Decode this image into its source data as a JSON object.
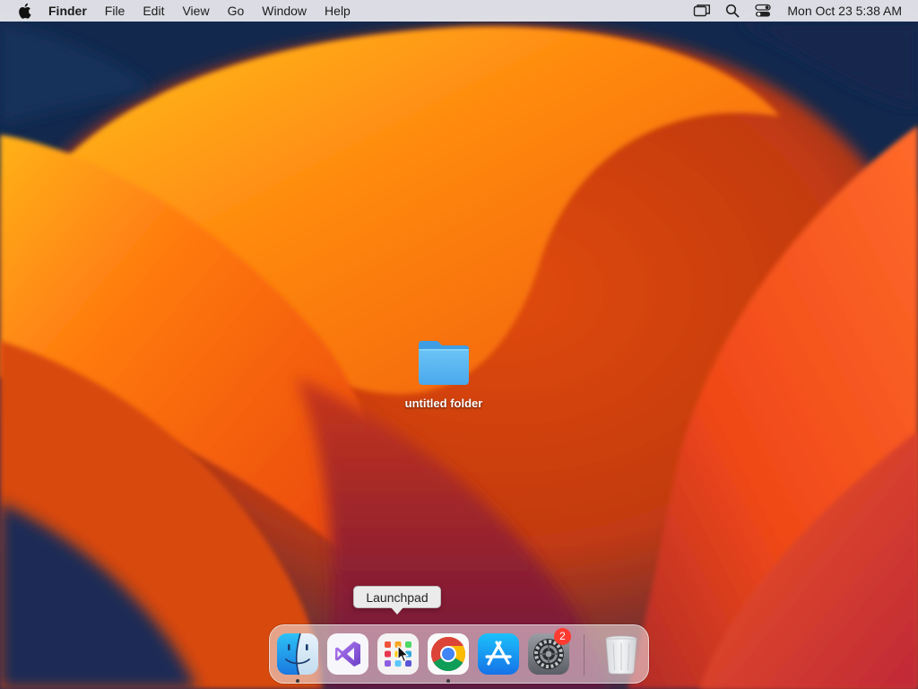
{
  "menubar": {
    "app_name": "Finder",
    "menus": [
      "File",
      "Edit",
      "View",
      "Go",
      "Window",
      "Help"
    ],
    "status_icons": [
      "screen-mirroring-icon",
      "spotlight-search-icon",
      "control-center-icon"
    ],
    "clock": "Mon Oct 23  5:38 AM"
  },
  "desktop": {
    "folder_label": "untitled folder"
  },
  "dock": {
    "tooltip": "Launchpad",
    "items": [
      {
        "name": "Finder",
        "icon": "finder-icon",
        "running": true
      },
      {
        "name": "Visual Studio",
        "icon": "visual-studio-icon",
        "running": false
      },
      {
        "name": "Launchpad",
        "icon": "launchpad-icon",
        "running": false
      },
      {
        "name": "Google Chrome",
        "icon": "chrome-icon",
        "running": true
      },
      {
        "name": "App Store",
        "icon": "app-store-icon",
        "running": false
      },
      {
        "name": "System Settings",
        "icon": "system-settings-icon",
        "running": false,
        "badge": "2"
      },
      {
        "name": "Trash",
        "icon": "trash-icon",
        "running": false
      }
    ]
  },
  "colors": {
    "folder": "#5ab4f0",
    "badge": "#ff3b30",
    "wallpaper_orange": "#f06010",
    "wallpaper_navy": "#12284d"
  }
}
